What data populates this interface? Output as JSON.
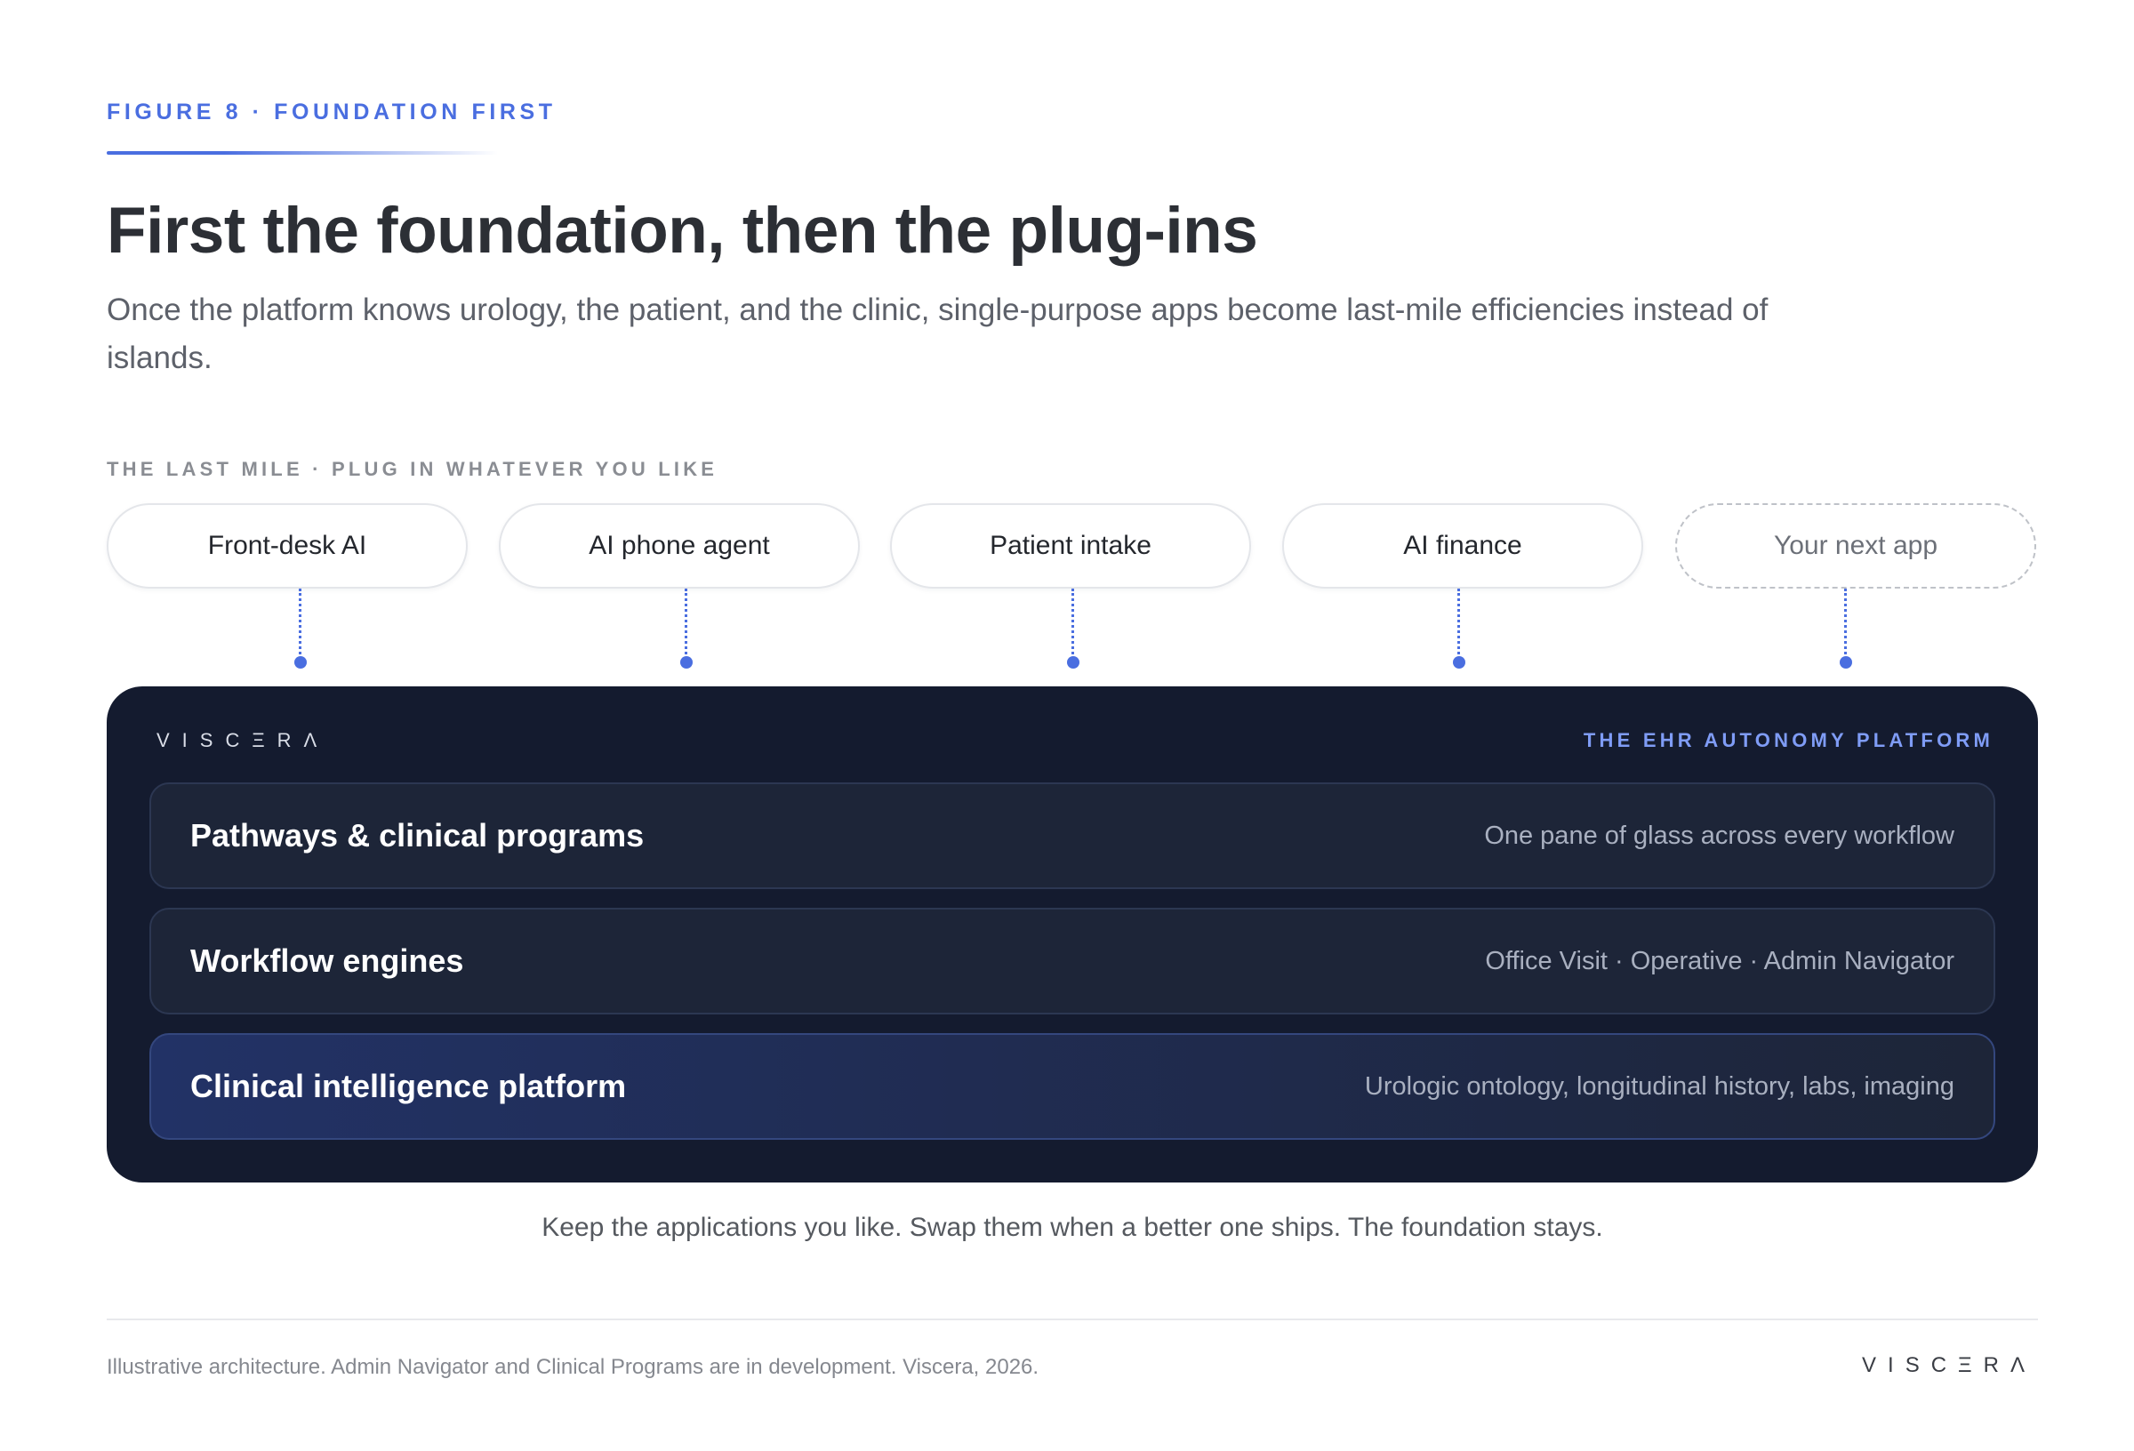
{
  "header": {
    "eyebrow": "FIGURE 8 · FOUNDATION FIRST",
    "title": "First the foundation, then the plug-ins",
    "subtitle": "Once the platform knows urology, the patient, and the clinic, single-purpose apps become last-mile efficiencies instead of islands."
  },
  "last_mile": {
    "label": "THE LAST MILE · PLUG IN WHATEVER YOU LIKE",
    "apps": [
      {
        "label": "Front-desk AI"
      },
      {
        "label": "AI phone agent"
      },
      {
        "label": "Patient intake"
      },
      {
        "label": "AI finance"
      },
      {
        "label": "Your next app"
      }
    ]
  },
  "platform": {
    "logo": "VISCΞRΛ",
    "tag": "THE EHR AUTONOMY PLATFORM",
    "layers": [
      {
        "name": "Pathways & clinical programs",
        "desc": "One pane of glass across every workflow"
      },
      {
        "name": "Workflow engines",
        "desc": "Office Visit · Operative · Admin Navigator"
      },
      {
        "name": "Clinical intelligence platform",
        "desc": "Urologic ontology, longitudinal history, labs, imaging"
      }
    ]
  },
  "caption": "Keep the applications you like. Swap them when a better one ships. The foundation stays.",
  "footer": {
    "note": "Illustrative architecture. Admin Navigator and Clinical Programs are in development. Viscera, 2026.",
    "logo": "VISCΞRΛ"
  },
  "colors": {
    "accent": "#4a6ee0",
    "platform_bg": "#141b2f",
    "layer_bg": "#1d2538",
    "platform_tag": "#7f9cf6"
  }
}
